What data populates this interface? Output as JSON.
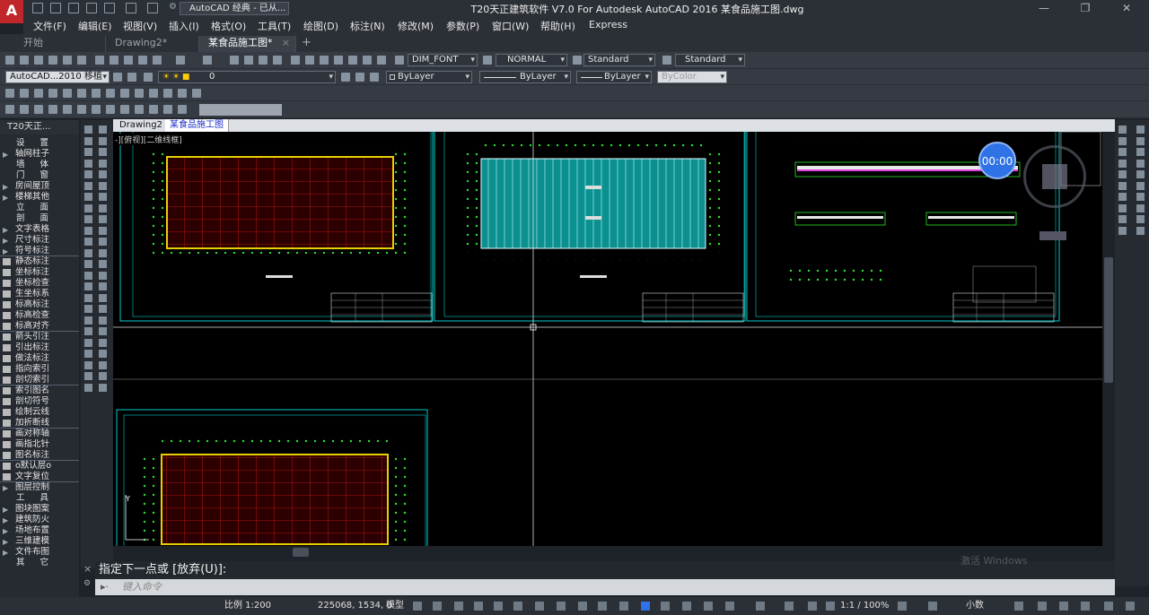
{
  "app": {
    "title": "T20天正建筑软件 V7.0 For Autodesk AutoCAD 2016    某食品施工图.dwg",
    "workspace": "AutoCAD 经典 - 已从..."
  },
  "menu": [
    "文件(F)",
    "编辑(E)",
    "视图(V)",
    "插入(I)",
    "格式(O)",
    "工具(T)",
    "绘图(D)",
    "标注(N)",
    "修改(M)",
    "参数(P)",
    "窗口(W)",
    "帮助(H)",
    "Express"
  ],
  "file_tabs": [
    {
      "label": "开始",
      "active": false
    },
    {
      "label": "Drawing2*",
      "active": false
    },
    {
      "label": "某食品施工图*",
      "active": true
    }
  ],
  "styles": {
    "text_style": "DIM_FONT",
    "dim_style": "NORMAL",
    "table_style": "Standard",
    "mleader_style": "Standard"
  },
  "layers": {
    "workspace2": "AutoCAD...2010 移植",
    "current_layer": "0",
    "color": "ByLayer",
    "linetype": "ByLayer",
    "lineweight": "ByLayer",
    "plotstyle": "ByColor"
  },
  "left_panel": {
    "title": "T20天正...",
    "items": [
      {
        "label": "设 置",
        "kind": "spaced"
      },
      {
        "label": "轴网柱子",
        "kind": "tri"
      },
      {
        "label": "墙 体",
        "kind": "spaced"
      },
      {
        "label": "门 窗",
        "kind": "spaced"
      },
      {
        "label": "房间屋顶",
        "kind": "tri"
      },
      {
        "label": "楼梯其他",
        "kind": "tri"
      },
      {
        "label": "立 面",
        "kind": "spaced"
      },
      {
        "label": "剖 面",
        "kind": "spaced"
      },
      {
        "label": "文字表格",
        "kind": "tri"
      },
      {
        "label": "尺寸标注",
        "kind": "tri"
      },
      {
        "label": "符号标注",
        "kind": "tri"
      },
      {
        "label": "静态标注",
        "kind": "icon",
        "sep": true
      },
      {
        "label": "坐标标注",
        "kind": "icon"
      },
      {
        "label": "坐标检查",
        "kind": "icon"
      },
      {
        "label": "生坐标系",
        "kind": "icon"
      },
      {
        "label": "标高标注",
        "kind": "icon"
      },
      {
        "label": "标高检查",
        "kind": "icon"
      },
      {
        "label": "标高对齐",
        "kind": "icon"
      },
      {
        "label": "箭头引注",
        "kind": "icon",
        "sep": true
      },
      {
        "label": "引出标注",
        "kind": "icon"
      },
      {
        "label": "做法标注",
        "kind": "icon"
      },
      {
        "label": "指向索引",
        "kind": "icon"
      },
      {
        "label": "剖切索引",
        "kind": "icon"
      },
      {
        "label": "索引图名",
        "kind": "icon",
        "sep": true
      },
      {
        "label": "剖切符号",
        "kind": "icon"
      },
      {
        "label": "绘制云线",
        "kind": "icon"
      },
      {
        "label": "加折断线",
        "kind": "icon"
      },
      {
        "label": "画对称轴",
        "kind": "icon",
        "sep": true
      },
      {
        "label": "画指北针",
        "kind": "icon"
      },
      {
        "label": "图名标注",
        "kind": "icon"
      },
      {
        "label": "o默认层o",
        "kind": "icon",
        "sep": true
      },
      {
        "label": "文字复位",
        "kind": "icon"
      },
      {
        "label": "图层控制",
        "kind": "tri",
        "sep": true
      },
      {
        "label": "工 具",
        "kind": "spaced"
      },
      {
        "label": "图块图案",
        "kind": "tri"
      },
      {
        "label": "建筑防火",
        "kind": "tri"
      },
      {
        "label": "场地布置",
        "kind": "tri"
      },
      {
        "label": "三维建模",
        "kind": "tri"
      },
      {
        "label": "文件布图",
        "kind": "tri"
      },
      {
        "label": "其 它",
        "kind": "spaced"
      }
    ]
  },
  "doc_tabs": [
    {
      "label": "Drawing2",
      "active": false
    },
    {
      "label": "某食品施工图",
      "active": true
    }
  ],
  "viewport_label": "-][俯视][二维线框]",
  "timer": "00:00",
  "command": {
    "prompt": "指定下一点或 [放弃(U)]:",
    "input_placeholder": "键入命令"
  },
  "status": {
    "scale": "比例 1:200",
    "coords": "225068, 1534, 0",
    "model": "模型",
    "anno_scale": "1:1 / 100%",
    "units": "小数"
  },
  "watermark": "激活 Windows",
  "colors": {
    "accent": "#2f72e6",
    "red_fill": "#3a0000",
    "teal_roof": "#0c8c8c",
    "frame_green": "#00c8c8",
    "yellow": "#e8d000"
  }
}
